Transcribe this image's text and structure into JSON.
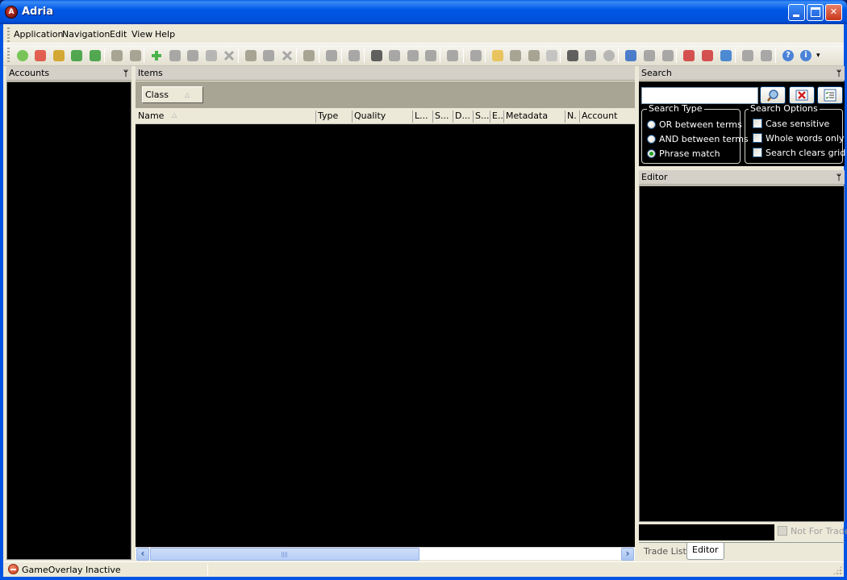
{
  "window": {
    "title": "Adria",
    "app_icon_glyph": "A",
    "controls": {
      "minimize": "minimize",
      "maximize": "maximize",
      "close": "close"
    }
  },
  "menubar": {
    "items": [
      {
        "label": "Application"
      },
      {
        "label": "Navigation"
      },
      {
        "label": "Edit"
      },
      {
        "label": "View"
      },
      {
        "label": "Help"
      }
    ]
  },
  "toolbar": {
    "buttons": [
      {
        "icon": "check-icon",
        "color": "#6cc04a"
      },
      {
        "icon": "first-aid-kit-icon",
        "color": "#e05040"
      },
      {
        "icon": "gear-document-icon",
        "color": "#d0a020"
      },
      {
        "icon": "export-icon",
        "color": "#40a040"
      },
      {
        "icon": "import-icon",
        "color": "#40a040"
      },
      {
        "icon": "document-gray-icon",
        "color": "#a09c8c"
      },
      {
        "icon": "document-gray-2-icon",
        "color": "#a09c8c"
      },
      {
        "icon": "add-icon",
        "color": "#3cac3c"
      },
      {
        "icon": "add-user-icon",
        "color": "#a0a0a0"
      },
      {
        "icon": "edit-icon",
        "color": "#a0a0a0"
      },
      {
        "icon": "eraser-icon",
        "color": "#b0b0b0"
      },
      {
        "icon": "delete-icon",
        "color": "#a0a0a0"
      },
      {
        "icon": "notes-icon",
        "color": "#a09c8c"
      },
      {
        "icon": "link-icon",
        "color": "#a0a0a0"
      },
      {
        "icon": "delete-2-icon",
        "color": "#a0a0a0"
      },
      {
        "icon": "blank-icon",
        "color": "#a09c8c"
      },
      {
        "icon": "spellcheck-icon",
        "color": "#a0a0a0"
      },
      {
        "icon": "clear-table-icon",
        "color": "#a0a0a0"
      },
      {
        "icon": "select-icon",
        "color": "#505050"
      },
      {
        "icon": "copy-icon",
        "color": "#a0a0a0"
      },
      {
        "icon": "cut-icon",
        "color": "#a0a0a0"
      },
      {
        "icon": "paste-icon",
        "color": "#a0a0a0"
      },
      {
        "icon": "undo-icon",
        "color": "#a0a0a0"
      },
      {
        "icon": "save-icon",
        "color": "#a0a0a0"
      },
      {
        "icon": "open-folder-icon",
        "color": "#e8c050"
      },
      {
        "icon": "blank-2-icon",
        "color": "#a09c8c"
      },
      {
        "icon": "blank-3-icon",
        "color": "#a09c8c"
      },
      {
        "icon": "settings-icon",
        "color": "#c0c0c0"
      },
      {
        "icon": "select-2-icon",
        "color": "#505050"
      },
      {
        "icon": "copy-2-icon",
        "color": "#a0a0a0"
      },
      {
        "icon": "back-icon",
        "color": "#b0b0b0"
      },
      {
        "icon": "grid-icon",
        "color": "#3a70c8"
      },
      {
        "icon": "magic-wand-icon",
        "color": "#a0a0a0"
      },
      {
        "icon": "magic-wand-price-icon",
        "color": "#a0a0a0"
      },
      {
        "icon": "trade-out-icon",
        "color": "#d04040"
      },
      {
        "icon": "trade-price-icon",
        "color": "#d04040"
      },
      {
        "icon": "trade-window-icon",
        "color": "#3a80d0"
      },
      {
        "icon": "spellcheck-2-icon",
        "color": "#a0a0a0"
      },
      {
        "icon": "find-document-icon",
        "color": "#a0a0a0"
      },
      {
        "icon": "help-icon",
        "color": "#3a78d8"
      },
      {
        "icon": "info-icon",
        "color": "#3a78d8"
      }
    ],
    "overflow_glyph": "▾"
  },
  "accounts": {
    "title": "Accounts",
    "pin_glyph": "⊥"
  },
  "items": {
    "title": "Items",
    "group_by": {
      "label": "Class",
      "sort": "ascending"
    },
    "columns": [
      {
        "label": "Name",
        "sorted": "ascending"
      },
      {
        "label": "Type"
      },
      {
        "label": "Quality"
      },
      {
        "label": "L..."
      },
      {
        "label": "S..."
      },
      {
        "label": "D..."
      },
      {
        "label": "S..."
      },
      {
        "label": "E.."
      },
      {
        "label": "Metadata"
      },
      {
        "label": "N."
      },
      {
        "label": "Account"
      }
    ],
    "rows": [],
    "scroll": {
      "left": "‹",
      "right": "›"
    }
  },
  "search": {
    "title": "Search",
    "query_value": "",
    "buttons": {
      "search": "search-icon",
      "clear": "clear-icon",
      "options": "checklist-icon"
    },
    "search_type": {
      "legend": "Search Type",
      "options": [
        {
          "label": "OR between terms",
          "checked": false
        },
        {
          "label": "AND between terms",
          "checked": false
        },
        {
          "label": "Phrase match",
          "checked": true
        }
      ]
    },
    "search_options": {
      "legend": "Search Options",
      "options": [
        {
          "label": "Case sensitive",
          "checked": false
        },
        {
          "label": "Whole words only",
          "checked": false
        },
        {
          "label": "Search clears grid",
          "checked": false
        }
      ]
    }
  },
  "editor": {
    "title": "Editor",
    "field_value": "",
    "not_for_trade": {
      "label": "Not For Trade",
      "checked": false,
      "enabled": false
    },
    "tabs": [
      {
        "label": "Trade List",
        "active": false
      },
      {
        "label": "Editor",
        "active": true
      }
    ]
  },
  "statusbar": {
    "text": "GameOverlay Inactive",
    "status": "inactive"
  }
}
